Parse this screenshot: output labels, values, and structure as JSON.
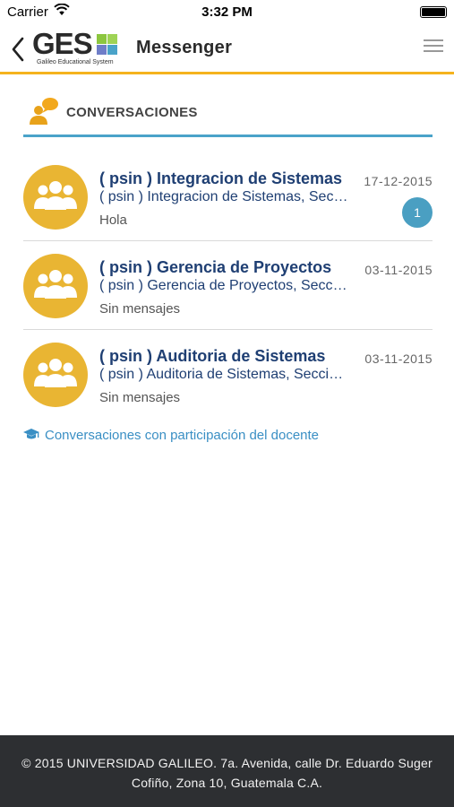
{
  "status_bar": {
    "carrier": "Carrier",
    "time": "3:32 PM"
  },
  "nav": {
    "logo_text": "GES",
    "logo_subtitle": "Galileo Educational System",
    "title": "Messenger",
    "accent_color": "#f5b31d"
  },
  "section": {
    "title": "CONVERSACIONES",
    "line_color": "#4aa3c9"
  },
  "conversations": [
    {
      "title": "( psin ) Integracion de Sistemas",
      "subtitle": "( psin ) Integracion de Sistemas, Seccion A",
      "last_message": "Hola",
      "date": "17-12-2015",
      "unread": "1"
    },
    {
      "title": "( psin ) Gerencia de Proyectos",
      "subtitle": "( psin ) Gerencia de Proyectos, Seccion A",
      "last_message": "Sin mensajes",
      "date": "03-11-2015",
      "unread": ""
    },
    {
      "title": "( psin ) Auditoria de Sistemas",
      "subtitle": "( psin ) Auditoria de Sistemas, Seccion A",
      "last_message": "Sin mensajes",
      "date": "03-11-2015",
      "unread": ""
    }
  ],
  "teacher_link": "Conversaciones con participación del docente",
  "footer": {
    "line1": "© 2015 UNIVERSIDAD GALILEO. 7a. Avenida, calle Dr. Eduardo Suger",
    "line2": "Cofiño, Zona 10, Guatemala C.A."
  }
}
